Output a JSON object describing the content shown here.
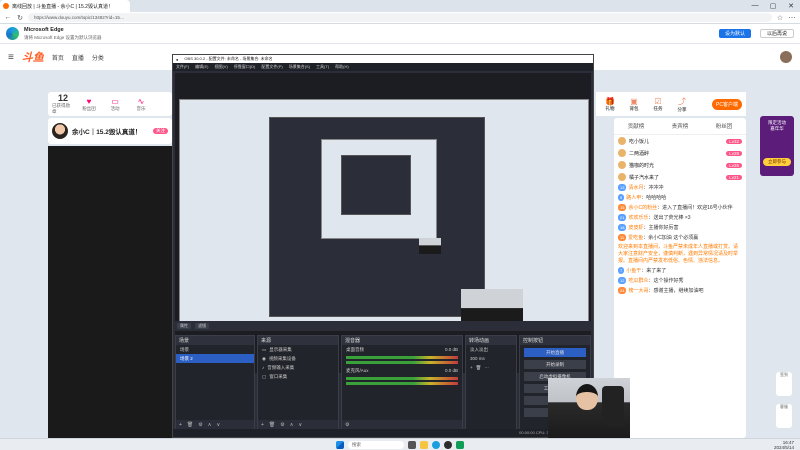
{
  "browser": {
    "tab_title": "离线回放 | 斗鱼直播 - 余小C | 15.2毁认真道！",
    "url": "https://www.douyu.com/topic/13492?rid=15…",
    "win_controls": [
      "—",
      "▢",
      "✕"
    ]
  },
  "infobar": {
    "title": "Microsoft Edge",
    "subtitle": "请将 Microsoft Edge 设置为默认浏览器",
    "primary_btn": "设为默认",
    "secondary_btn": "以后再说"
  },
  "site": {
    "logo": "斗鱼",
    "nav": [
      "首页",
      "直播",
      "分类"
    ],
    "room_toolbar": [
      {
        "value": "12",
        "label": "已获得勋章"
      },
      {
        "value": "♥",
        "label": "粉丝团"
      },
      {
        "value": "▭",
        "label": "活动"
      },
      {
        "value": "∿",
        "label": "音乐"
      }
    ],
    "anchor_name": "余小C｜15.2毁认真道！",
    "follow": "关注",
    "ribbon_right": [
      "礼物",
      "背包",
      "任务",
      "分享"
    ],
    "pc_button": "PC客户端",
    "pc_sub": "下载斗鱼PC客户端"
  },
  "chat": {
    "tabs": [
      "贡献榜",
      "贵宾榜",
      "粉丝团"
    ],
    "ranks": [
      {
        "name": "吃小饭儿",
        "badge": "Lv32"
      },
      {
        "name": "二两酒醉",
        "badge": "Lv28"
      },
      {
        "name": "猫咖的时光",
        "badge": "Lv26"
      },
      {
        "name": "橘子汽水来了",
        "badge": "Lv21"
      }
    ],
    "messages": [
      {
        "lv": "13",
        "user": "清水月",
        "text": "冲冲冲"
      },
      {
        "lv": "9",
        "user": "路人甲",
        "text": "哈哈哈哈"
      },
      {
        "lv": "15",
        "user": "余小C的粉丝",
        "text": "进入了直播间！欢迎16号小伙伴"
      },
      {
        "lv": "21",
        "user": "欢欢乐乐",
        "text": "送出了荧光棒 ×3"
      },
      {
        "lv": "18",
        "user": "皮皮虾",
        "text": "主播你好厉害"
      },
      {
        "lv": "11",
        "user": "爱吃鱼",
        "text": "余小C加油 这个必须赢"
      }
    ],
    "notice": "欢迎来到本直播间，斗鱼严禁未成年人直播或打赏。请大家注意财产安全，谨慎判断，遇到异常情况请及时举报。直播间内严禁发布低俗、色情、违法信息。",
    "tail_messages": [
      {
        "lv": "7",
        "user": "小鱼干",
        "text": "来了来了"
      },
      {
        "lv": "12",
        "user": "吃瓜群众",
        "text": "这个操作好秀"
      },
      {
        "lv": "24",
        "user": "榜一大哥",
        "text": "感谢主播，继续加油吧"
      }
    ]
  },
  "event_card": {
    "title": "限定活动",
    "subtitle": "嘉年华",
    "button": "立即参与"
  },
  "side_floats": [
    "签到",
    "客服"
  ],
  "obs": {
    "title": "OBS 30.0.2 - 配置文件: 未命名 - 场景集合: 未命名",
    "menu": [
      "文件(F)",
      "编辑(E)",
      "视图(V)",
      "停靠窗口(D)",
      "配置文件(P)",
      "场景集合(S)",
      "工具(T)",
      "帮助(H)"
    ],
    "controls_bar": [
      "属性",
      "滤镜"
    ],
    "docks": {
      "scenes": {
        "title": "场景",
        "items": [
          "场景",
          "场景 2"
        ]
      },
      "sources": {
        "title": "来源",
        "items": [
          "显示器采集",
          "视频采集设备",
          "音频输入采集",
          "窗口采集"
        ]
      },
      "mixer": {
        "title": "混音器",
        "items": [
          "桌面音频",
          "麦克风/Aux"
        ],
        "levels": [
          "0.0 dB",
          "0.0 dB"
        ]
      },
      "transitions": {
        "title": "转场动画",
        "items": [
          "淡入淡出"
        ],
        "duration": "300 ms"
      },
      "controls": {
        "title": "控制按钮",
        "items": [
          "开始直播",
          "开始录制",
          "启动虚拟摄像机",
          "工作室模式",
          "设置",
          "退出"
        ]
      }
    },
    "status": "00:00:00  CPU: 3.1%  60.00 / 60.00 FPS"
  },
  "taskbar": {
    "search": "搜索",
    "time": "16:47",
    "date": "2024/5/14"
  }
}
